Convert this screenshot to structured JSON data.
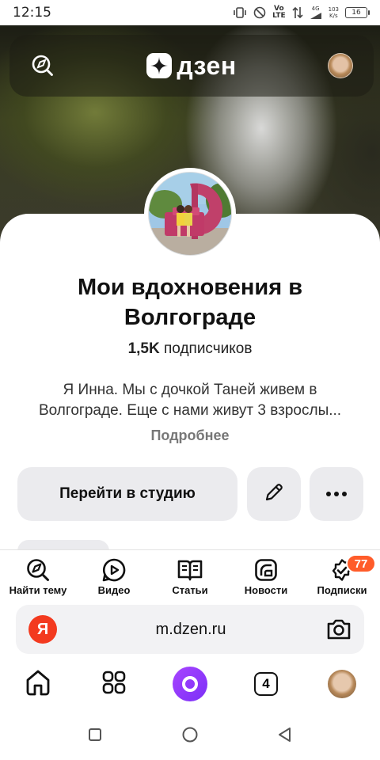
{
  "status_bar": {
    "time": "12:15",
    "net_top": "Vo",
    "net_bottom": "LTE",
    "gen": "4G",
    "speed_top": "103",
    "speed_bottom": "K/s",
    "battery": "16"
  },
  "header": {
    "logo_text": "дзен"
  },
  "channel": {
    "title": "Мои вдохновения в Волгограде",
    "subscribers_count": "1,5K",
    "subscribers_label": "подписчиков",
    "description_line1": "Я Инна. Мы с дочкой Таней живем в",
    "description_line2": "Волгограде. Еще с нами живут 3 взрослы...",
    "more_label": "Подробнее"
  },
  "actions": {
    "studio_label": "Перейти в студию"
  },
  "bottom_nav": {
    "items": [
      {
        "label": "Найти тему"
      },
      {
        "label": "Видео"
      },
      {
        "label": "Статьи"
      },
      {
        "label": "Новости"
      },
      {
        "label": "Подписки"
      }
    ],
    "subscriptions_badge": "77"
  },
  "browser": {
    "ya_letter": "Я",
    "url": "m.dzen.ru",
    "tabs_count": "4"
  },
  "colors": {
    "accent_badge": "#ff5c2a",
    "yandex_red": "#f33a1f",
    "alice_purple": "#8a3bfa"
  }
}
